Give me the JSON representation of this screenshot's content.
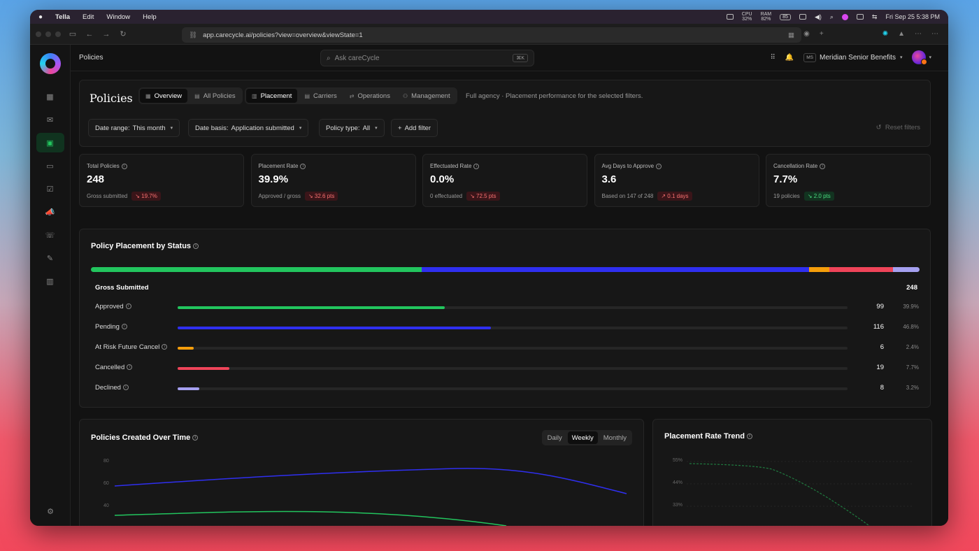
{
  "menubar": {
    "app": "Tella",
    "items": [
      "Edit",
      "Window",
      "Help"
    ],
    "cpu": "32%",
    "ram": "82%",
    "battery": "85",
    "clock": "Fri Sep 25  5:38 PM"
  },
  "browser": {
    "url": "app.carecycle.ai/policies?view=overview&viewState=1"
  },
  "topbar": {
    "breadcrumb": "Policies",
    "search_placeholder": "Ask careCycle",
    "search_kbd": "⌘K",
    "org_initials": "MS",
    "org_name": "Meridian Senior Benefits"
  },
  "header": {
    "title": "Policies",
    "view_tabs": [
      {
        "label": "Overview",
        "active": true
      },
      {
        "label": "All Policies",
        "active": false
      }
    ],
    "section_tabs": [
      {
        "label": "Placement",
        "active": true
      },
      {
        "label": "Carriers",
        "active": false
      },
      {
        "label": "Operations",
        "active": false
      },
      {
        "label": "Management",
        "active": false
      }
    ],
    "description": "Full agency · Placement performance for the selected filters.",
    "filters": [
      {
        "label": "Date range:",
        "value": "This month"
      },
      {
        "label": "Date basis:",
        "value": "Application submitted"
      },
      {
        "label": "Policy type:",
        "value": "All"
      }
    ],
    "add_filter": "Add filter",
    "reset": "Reset filters"
  },
  "kpis": [
    {
      "label": "Total Policies",
      "value": "248",
      "sub": "Gross submitted",
      "delta": "↘ 19.7%",
      "tone": "red"
    },
    {
      "label": "Placement Rate",
      "value": "39.9%",
      "sub": "Approved / gross",
      "delta": "↘ 32.6 pts",
      "tone": "red"
    },
    {
      "label": "Effectuated Rate",
      "value": "0.0%",
      "sub": "0 effectuated",
      "delta": "↘ 72.5 pts",
      "tone": "red"
    },
    {
      "label": "Avg Days to Approve",
      "value": "3.6",
      "sub": "Based on 147 of 248",
      "delta": "↗ 0.1 days",
      "tone": "red"
    },
    {
      "label": "Cancellation Rate",
      "value": "7.7%",
      "sub": "19 policies",
      "delta": "↘ 2.0 pts",
      "tone": "green"
    }
  ],
  "placement": {
    "title": "Policy Placement by Status",
    "gross_label": "Gross Submitted",
    "gross_value": "248",
    "statuses": [
      {
        "name": "Approved",
        "count": "99",
        "pct": "39.9%",
        "fraction": 0.399,
        "color": "#22c55e"
      },
      {
        "name": "Pending",
        "count": "116",
        "pct": "46.8%",
        "fraction": 0.468,
        "color": "#2f2ff0"
      },
      {
        "name": "At Risk Future Cancel",
        "count": "6",
        "pct": "2.4%",
        "fraction": 0.024,
        "color": "#f59e0b"
      },
      {
        "name": "Cancelled",
        "count": "19",
        "pct": "7.7%",
        "fraction": 0.077,
        "color": "#ef4459"
      },
      {
        "name": "Declined",
        "count": "8",
        "pct": "3.2%",
        "fraction": 0.032,
        "color": "#a5a0f0"
      }
    ]
  },
  "created": {
    "title": "Policies Created Over Time",
    "toggle": [
      {
        "label": "Daily",
        "active": false
      },
      {
        "label": "Weekly",
        "active": true
      },
      {
        "label": "Monthly",
        "active": false
      }
    ],
    "y_ticks": [
      "80",
      "60",
      "40"
    ]
  },
  "trend": {
    "title": "Placement Rate Trend",
    "y_ticks": [
      "55%",
      "44%",
      "33%"
    ]
  }
}
